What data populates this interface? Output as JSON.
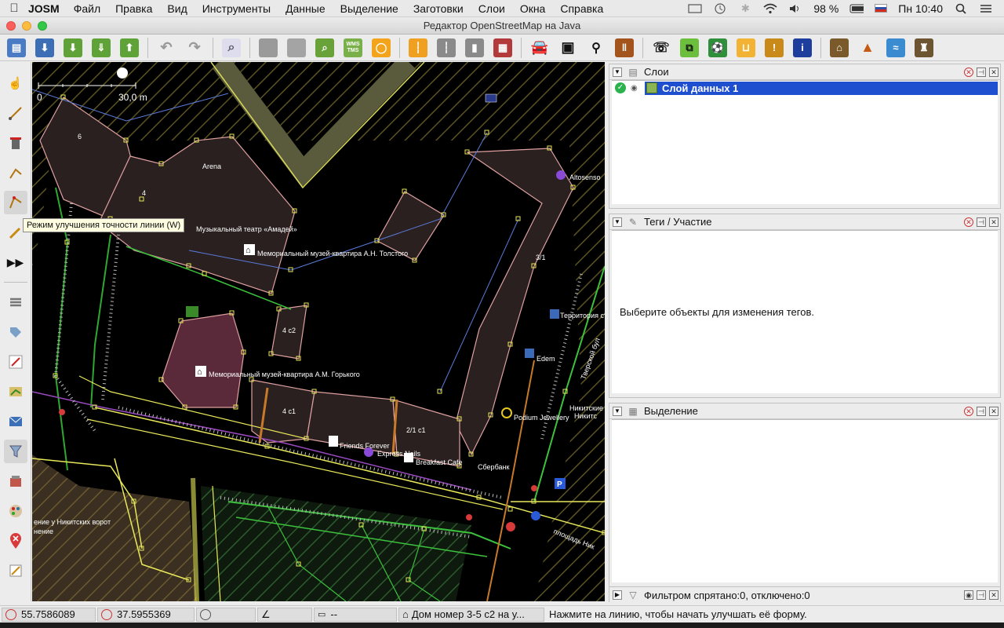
{
  "menubar": {
    "app_name": "JOSM",
    "menus": [
      "Файл",
      "Правка",
      "Вид",
      "Инструменты",
      "Данные",
      "Выделение",
      "Заготовки",
      "Слои",
      "Окна",
      "Справка"
    ],
    "battery": "98 %",
    "clock": "Пн 10:40"
  },
  "window": {
    "title": "Редактор OpenStreetMap на Java"
  },
  "toolbar": {
    "icons": [
      "open-file-icon",
      "save-icon",
      "download-icon",
      "download-area-icon",
      "upload-icon",
      "undo-icon",
      "redo-icon",
      "preferences-icon",
      "select-all-icon",
      "copy-icon",
      "zoom-icon",
      "wms-tms-icon",
      "lasso-icon",
      "road-marking-icon",
      "road-divider-icon",
      "crossing-icon",
      "wall-icon",
      "car-icon",
      "bus-icon",
      "bicycle-icon",
      "railway-icon",
      "phone-icon",
      "bus-stop-icon",
      "sports-icon",
      "shop-icon",
      "warning-icon",
      "info-icon",
      "industrial-icon",
      "mountain-icon",
      "water-icon",
      "castle-icon"
    ],
    "wms_label": "WMS\nTMS"
  },
  "lefttools": [
    "select-tool-icon",
    "draw-tool-icon",
    "delete-tool-icon",
    "parallel-tool-icon",
    "improve-way-tool-icon",
    "sketch-tool-icon",
    "more-tools-icon",
    "layers-toggle-icon",
    "tags-toggle-icon",
    "relation-toggle-icon",
    "selection-toggle-icon",
    "validator-toggle-icon",
    "filter-toggle-icon",
    "history-toggle-icon",
    "style-toggle-icon",
    "notes-toggle-icon",
    "changeset-toggle-icon"
  ],
  "tooltip": {
    "text": "Режим улучшения точности линии (W)"
  },
  "map": {
    "scale_zero": "0",
    "scale_label": "30,0 m",
    "labels": [
      {
        "id": "house-6",
        "text": "6"
      },
      {
        "id": "house-4",
        "text": "4"
      },
      {
        "id": "arena",
        "text": "Arena"
      },
      {
        "id": "theatre",
        "text": "Музыкальный театр «Амадей»"
      },
      {
        "id": "tolstoy",
        "text": "Мемориальный музей-квартира А.Н. Толстого"
      },
      {
        "id": "altosenso",
        "text": "Altosenso"
      },
      {
        "id": "house-3-1",
        "text": "3/1"
      },
      {
        "id": "territory",
        "text": "Территория ст"
      },
      {
        "id": "house-4c2",
        "text": "4 с2"
      },
      {
        "id": "edem",
        "text": "Edem"
      },
      {
        "id": "gorky",
        "text": "Мемориальный музей-квартира А.М. Горького"
      },
      {
        "id": "house-4c1",
        "text": "4 с1"
      },
      {
        "id": "house-2-1c1",
        "text": "2/1 с1"
      },
      {
        "id": "podium",
        "text": "Podium Jewellery"
      },
      {
        "id": "nikitskie",
        "text": "Никитские Во"
      },
      {
        "id": "nikit2",
        "text": "Никитс"
      },
      {
        "id": "friends",
        "text": "Friends Forever"
      },
      {
        "id": "express",
        "text": "Express Nails"
      },
      {
        "id": "breakfast",
        "text": "Breakfast Cafe"
      },
      {
        "id": "sberbank",
        "text": "Сбербанк"
      },
      {
        "id": "nikitskie-vorot",
        "text": "ение у Никитских ворот"
      },
      {
        "id": "nenie",
        "text": "нение"
      },
      {
        "id": "square",
        "text": "площадь Ник"
      },
      {
        "id": "tver",
        "text": "Тверской бул"
      }
    ]
  },
  "panels": {
    "layers": {
      "title": "Слои",
      "items": [
        {
          "name": "Слой данных 1",
          "visible": true,
          "active": true
        }
      ]
    },
    "tags": {
      "title": "Теги / Участие",
      "empty_text": "Выберите объекты для изменения тегов."
    },
    "selection": {
      "title": "Выделение"
    },
    "filter": {
      "title": "Фильтром спрятано:0, отключено:0"
    }
  },
  "statusbar": {
    "lat": "55.7586089",
    "lon": "37.5955369",
    "heading": "",
    "angle": "",
    "distance": "--",
    "name": "Дом номер 3-5 с2 на у...",
    "help": "Нажмите на линию, чтобы начать улучшать её форму."
  },
  "colors": {
    "selected_layer": "#1d4fcf",
    "building_fill": "#2a2020",
    "building_outline": "#e0a0a0",
    "way_yellow": "#e8e85a",
    "way_green": "#3cc23c",
    "node_yellow": "#ffff00"
  }
}
